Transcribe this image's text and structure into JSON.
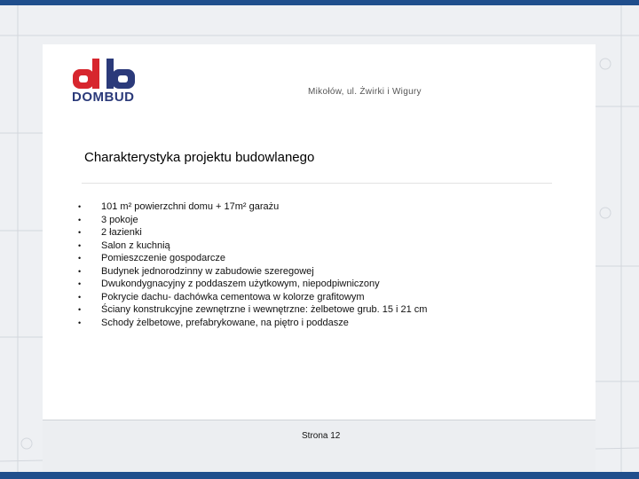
{
  "header": {
    "logo_text": "DOMBUD",
    "address": "Mikołów, ul. Żwirki i Wigury"
  },
  "slide": {
    "title": "Charakterystyka projektu budowlanego",
    "bullet_symbol": "•",
    "bullets": [
      "101 m² powierzchni domu + 17m² garażu",
      "3 pokoje",
      "2 łazienki",
      "Salon z kuchnią",
      "Pomieszczenie gospodarcze",
      "Budynek jednorodzinny  w zabudowie szeregowej",
      "Dwukondygnacyjny z poddaszem użytkowym, niepodpiwniczony",
      "Pokrycie dachu- dachówka  cementowa w kolorze grafitowym",
      "Ściany konstrukcyjne zewnętrzne i wewnętrzne: żelbetowe grub. 15 i 21 cm",
      "Schody żelbetowe, prefabrykowane, na piętro i poddasze"
    ]
  },
  "footer": {
    "page_label": "Strona 12"
  },
  "colors": {
    "brand_red": "#d7262e",
    "brand_blue": "#2b3a7a",
    "frame_blue": "#1f4e8c"
  }
}
